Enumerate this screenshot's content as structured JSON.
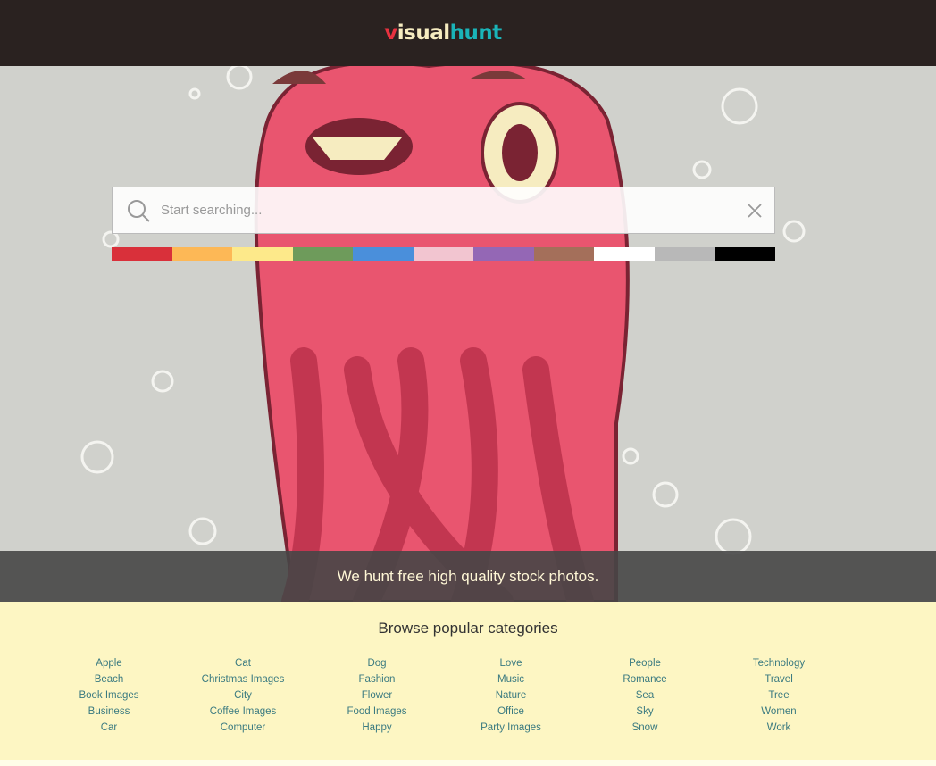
{
  "header": {
    "logo": {
      "v": "v",
      "isual": "isual",
      "hunt": "hunt"
    }
  },
  "search": {
    "placeholder": "Start searching...",
    "value": ""
  },
  "colors": [
    "#d9303a",
    "#fdb856",
    "#fde98a",
    "#6e9b5b",
    "#4a8fdb",
    "#f2c5d0",
    "#9467b5",
    "#a46f5a",
    "#ffffff",
    "#b8b8b8",
    "#000000"
  ],
  "tagline": "We hunt free high quality stock photos.",
  "categories": {
    "title": "Browse popular categories",
    "columns": [
      [
        "Apple",
        "Beach",
        "Book Images",
        "Business",
        "Car"
      ],
      [
        "Cat",
        "Christmas Images",
        "City",
        "Coffee Images",
        "Computer"
      ],
      [
        "Dog",
        "Fashion",
        "Flower",
        "Food Images",
        "Happy"
      ],
      [
        "Love",
        "Music",
        "Nature",
        "Office",
        "Party Images"
      ],
      [
        "People",
        "Romance",
        "Sea",
        "Sky",
        "Snow"
      ],
      [
        "Technology",
        "Travel",
        "Tree",
        "Women",
        "Work"
      ]
    ]
  }
}
